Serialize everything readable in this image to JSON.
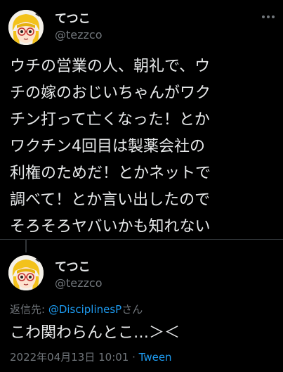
{
  "tweet": {
    "author_name": "てつこ",
    "author_handle": "@tezzco",
    "more_icon": "more-dots-icon",
    "body_lines": [
      "ウチの営業の人、朝礼で、ウ",
      "チの嫁のおじいちゃんがワク",
      "チン打って亡くなった！とか",
      "ワクチン4回目は製薬会社の",
      "利権のためだ！とかネットで",
      "調べて！とか言い出したので",
      "そろそろヤバいかも知れない"
    ]
  },
  "reply": {
    "author_name": "てつこ",
    "author_handle": "@tezzco",
    "reply_prefix": "返信先: ",
    "reply_mention": "@DisciplinesP",
    "reply_suffix": "さん",
    "text": "こわ関わらんとこ…＞＜",
    "timestamp": "2022年04月13日 10:01",
    "dot": " · ",
    "client": "Tween"
  },
  "colors": {
    "background": "#000000",
    "text": "#e7e9ea",
    "secondary": "#71767b",
    "link": "#1d9bf0",
    "divider": "#2f3336"
  }
}
